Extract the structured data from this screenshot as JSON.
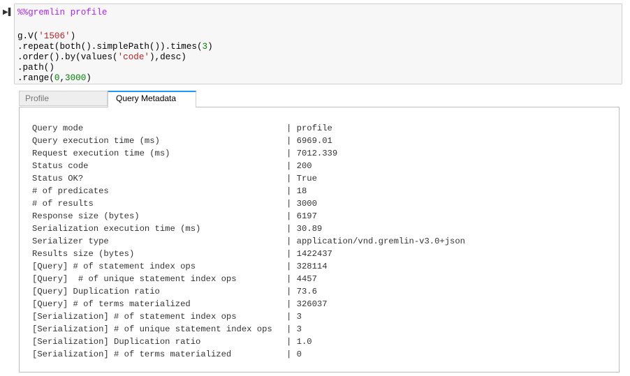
{
  "cell": {
    "run_icon": "run-cell-icon",
    "magic": "%%gremlin profile",
    "code": [
      {
        "a": "g.V(",
        "s": "'1506'",
        "b": ")"
      },
      {
        "a": ".repeat(both().simplePath()).times(",
        "n": "3",
        "b": ")"
      },
      {
        "a": ".order().by(values(",
        "s": "'code'",
        "b": "),desc)"
      },
      {
        "a": ".path()"
      },
      {
        "a": ".range(",
        "n": "0",
        "m": ",",
        "n2": "3000",
        "b": ")"
      }
    ]
  },
  "tabs": [
    {
      "label": "Profile",
      "active": false
    },
    {
      "label": "Query Metadata",
      "active": true
    }
  ],
  "metadata": [
    {
      "key": "Query mode",
      "value": "profile"
    },
    {
      "key": "Query execution time (ms)",
      "value": "6969.01"
    },
    {
      "key": "Request execution time (ms)",
      "value": "7012.339"
    },
    {
      "key": "Status code",
      "value": "200"
    },
    {
      "key": "Status OK?",
      "value": "True"
    },
    {
      "key": "# of predicates",
      "value": "18"
    },
    {
      "key": "# of results",
      "value": "3000"
    },
    {
      "key": "Response size (bytes)",
      "value": "6197"
    },
    {
      "key": "Serialization execution time (ms)",
      "value": "30.89"
    },
    {
      "key": "Serializer type",
      "value": "application/vnd.gremlin-v3.0+json"
    },
    {
      "key": "Results size (bytes)",
      "value": "1422437"
    },
    {
      "key": "[Query] # of statement index ops",
      "value": "328114"
    },
    {
      "key": "[Query]  # of unique statement index ops",
      "value": "4457"
    },
    {
      "key": "[Query] Duplication ratio",
      "value": "73.6"
    },
    {
      "key": "[Query] # of terms materialized",
      "value": "326037"
    },
    {
      "key": "[Serialization] # of statement index ops",
      "value": "3"
    },
    {
      "key": "[Serialization] # of unique statement index ops",
      "value": "3"
    },
    {
      "key": "[Serialization] Duplication ratio",
      "value": "1.0"
    },
    {
      "key": "[Serialization] # of terms materialized",
      "value": "0"
    }
  ]
}
